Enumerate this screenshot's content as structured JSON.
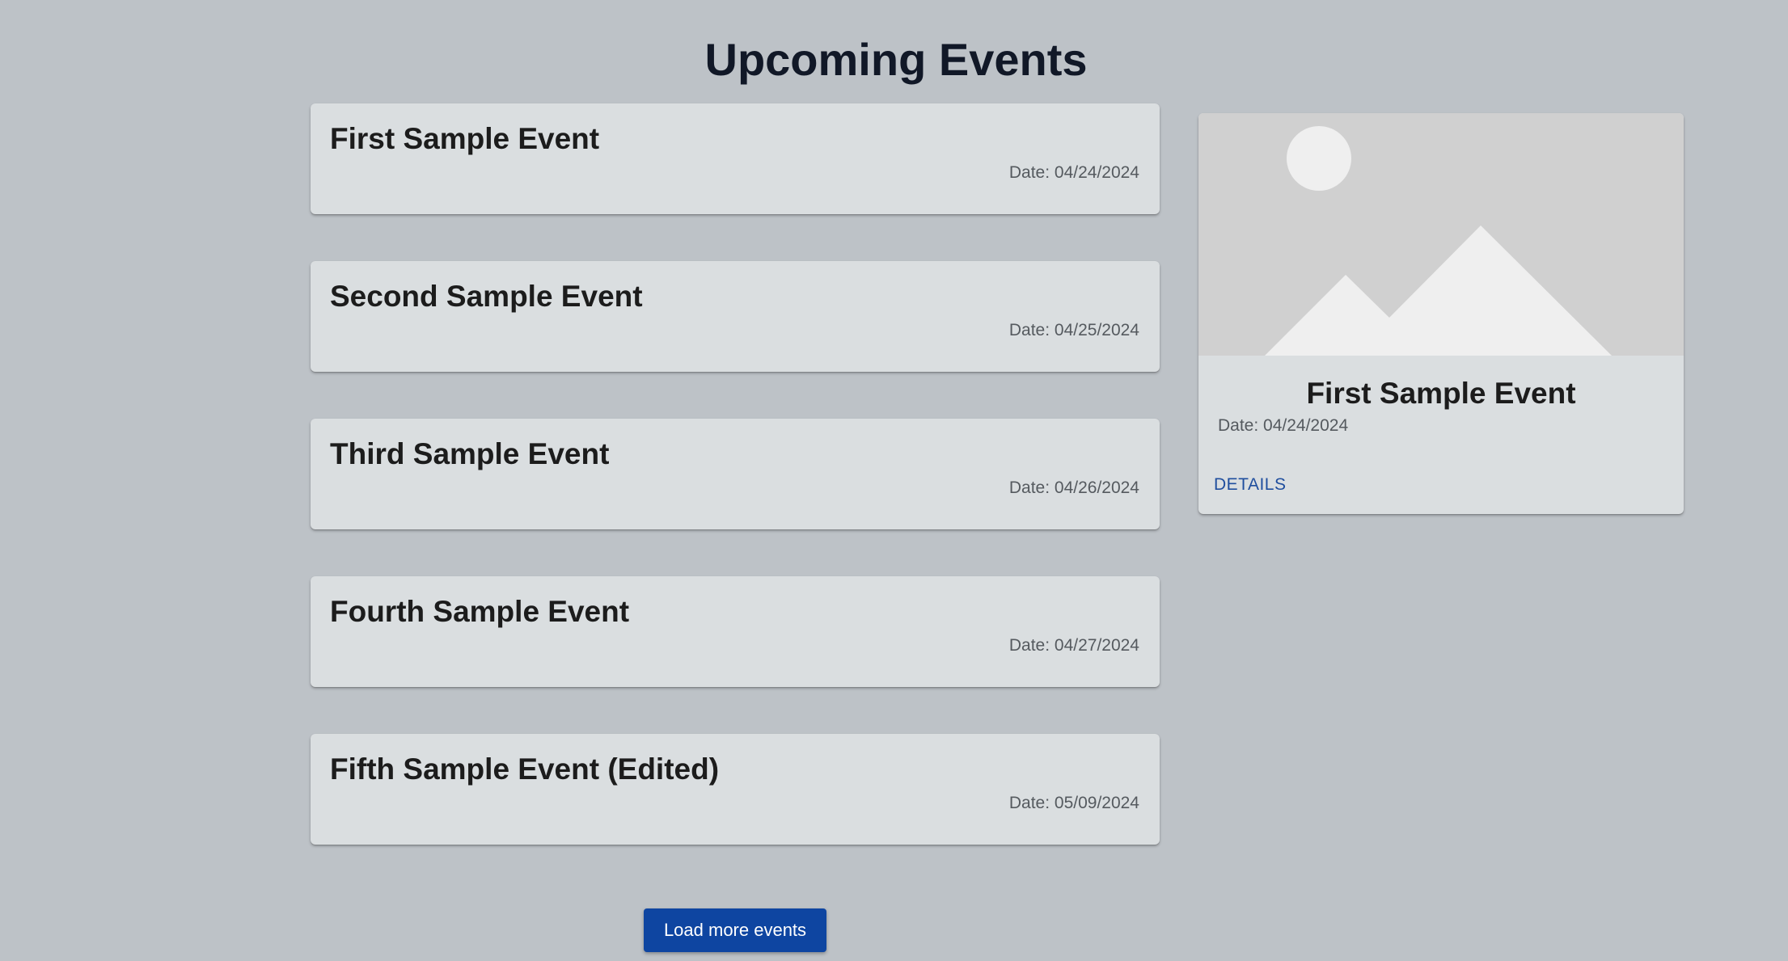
{
  "page": {
    "title": "Upcoming Events"
  },
  "events": [
    {
      "title": "First Sample Event",
      "date": "Date: 04/24/2024"
    },
    {
      "title": "Second Sample Event",
      "date": "Date: 04/25/2024"
    },
    {
      "title": "Third Sample Event",
      "date": "Date: 04/26/2024"
    },
    {
      "title": "Fourth Sample Event",
      "date": "Date: 04/27/2024"
    },
    {
      "title": "Fifth Sample Event (Edited)",
      "date": "Date: 05/09/2024"
    }
  ],
  "load_more": {
    "label": "Load more events"
  },
  "selected_event": {
    "image_icon": "image-placeholder-icon",
    "title": "First Sample Event",
    "date": "Date: 04/24/2024",
    "details_label": "DETAILS"
  },
  "colors": {
    "background": "#bdc2c7",
    "card": "#dadee0",
    "primary_button": "#0e45a1",
    "link": "#1f4e9e",
    "heading": "#111827"
  }
}
